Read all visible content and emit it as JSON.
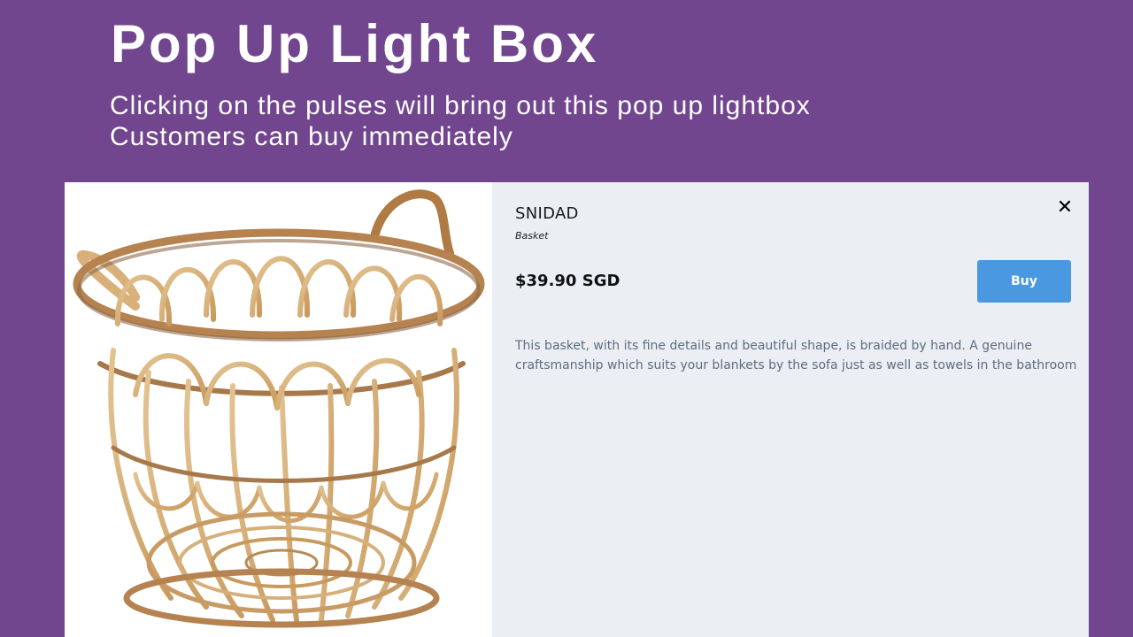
{
  "banner": {
    "title": "Pop Up Light Box",
    "subtitle_lines": [
      "Clicking on the pulses will bring out this pop up lightbox",
      "Customers can buy immediately"
    ]
  },
  "lightbox": {
    "product": {
      "name": "SNIDAD",
      "type": "Basket",
      "price": "$39.90 SGD",
      "description_lines": [
        "This basket, with its fine details and beautiful shape, is braided by hand. A genuine",
        "craftsmanship which suits your blankets by the sofa just as well as towels in the bathroom"
      ]
    },
    "buy_label": "Buy",
    "close_icon": "close-icon",
    "product_image": "rattan-basket-image"
  },
  "colors": {
    "background": "#71468e",
    "detail_panel": "#ebeff4",
    "buy_button": "#4a98e0",
    "description_text": "#5d6d82"
  }
}
